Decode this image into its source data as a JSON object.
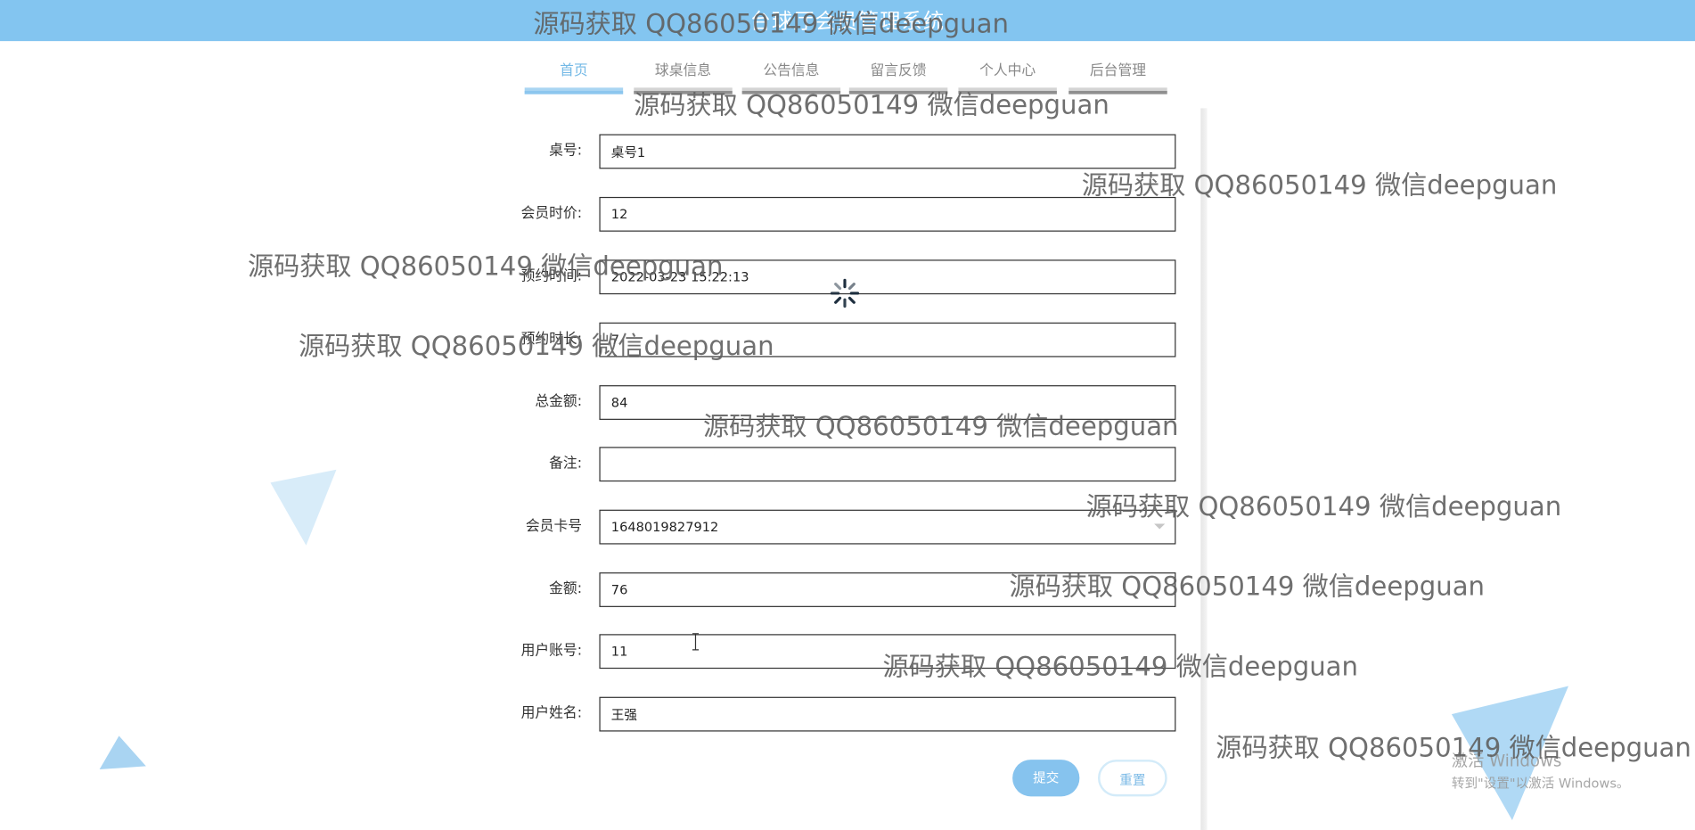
{
  "site": {
    "title": "台球厅会员管理系统"
  },
  "nav": {
    "tabs": [
      {
        "label": "首页",
        "active": true
      },
      {
        "label": "球桌信息",
        "active": false
      },
      {
        "label": "公告信息",
        "active": false
      },
      {
        "label": "留言反馈",
        "active": false
      },
      {
        "label": "个人中心",
        "active": false
      },
      {
        "label": "后台管理",
        "active": false
      }
    ]
  },
  "form": {
    "fields": [
      {
        "label": "桌号:",
        "value": "桌号1"
      },
      {
        "label": "会员时价:",
        "value": "12"
      },
      {
        "label": "预约时间:",
        "value": "2022-03-23 15:22:13"
      },
      {
        "label": "预约时长:",
        "value": "7"
      },
      {
        "label": "总金额:",
        "value": "84"
      },
      {
        "label": "备注:",
        "value": ""
      },
      {
        "label": "会员卡号",
        "value": "1648019827912"
      },
      {
        "label": "金额:",
        "value": "76"
      },
      {
        "label": "用户账号:",
        "value": "11"
      },
      {
        "label": "用户姓名:",
        "value": "王强"
      }
    ],
    "submit_label": "提交",
    "reset_label": "重置"
  },
  "watermark": {
    "text": "源码获取 QQ86050149 微信deepguan"
  },
  "windows_activation": {
    "line1": "激活 Windows",
    "line2": "转到\"设置\"以激活 Windows。"
  },
  "colors": {
    "header": "#83c5f0",
    "accent": "#86c3ee",
    "deco_triangle": "#a9d5f2"
  },
  "icons": {
    "spinner": "loading-spinner-icon",
    "select_arrow": "chevron-down-icon",
    "cursor": "text-cursor-icon"
  }
}
